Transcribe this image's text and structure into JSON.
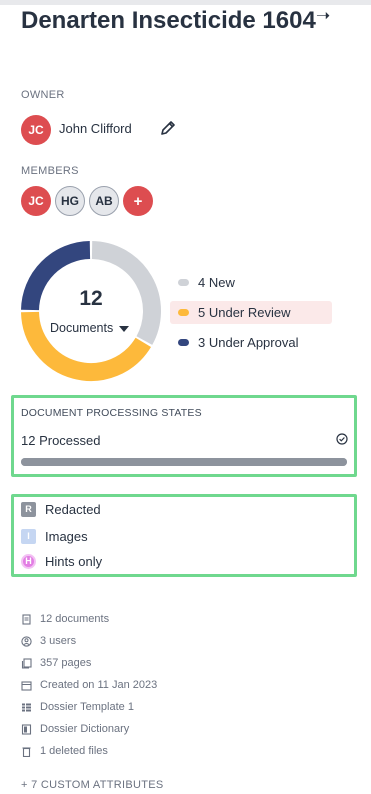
{
  "header": {
    "title": "Denarten Insecticide 1604",
    "collapse_icon": "arrow-right-icon"
  },
  "owner": {
    "label": "OWNER",
    "initials": "JC",
    "name": "John Clifford",
    "edit_icon": "pencil-icon"
  },
  "members": {
    "label": "MEMBERS",
    "items": [
      {
        "initials": "JC",
        "color": "#dd4d50"
      },
      {
        "initials": "HG",
        "color": "#e5e7eb"
      },
      {
        "initials": "AB",
        "color": "#e5e7eb"
      }
    ],
    "add_label": "+"
  },
  "documents_chart": {
    "count": "12",
    "selector_label": "Documents",
    "legend": [
      {
        "label": "4 New",
        "color": "#cfd2d7",
        "active": false
      },
      {
        "label": "5 Under Review",
        "color": "#fdb93b",
        "active": true
      },
      {
        "label": "3 Under Approval",
        "color": "#33467e",
        "active": false
      }
    ]
  },
  "chart_data": {
    "type": "pie",
    "categories": [
      "New",
      "Under Review",
      "Under Approval"
    ],
    "values": [
      4,
      5,
      3
    ],
    "colors": [
      "#cfd2d7",
      "#fdb93b",
      "#33467e"
    ]
  },
  "processing": {
    "label": "DOCUMENT PROCESSING STATES",
    "status": "12 Processed",
    "progress": 1.0,
    "status_icon": "check-circle-icon"
  },
  "filters": [
    {
      "chip": "R",
      "label": "Redacted",
      "type": "redacted"
    },
    {
      "chip": "I",
      "label": "Images",
      "type": "images"
    },
    {
      "chip": "H",
      "label": "Hints only",
      "type": "hints"
    }
  ],
  "stats": [
    {
      "icon": "document-icon",
      "label": "12 documents"
    },
    {
      "icon": "users-icon",
      "label": "3 users"
    },
    {
      "icon": "pages-icon",
      "label": "357 pages"
    },
    {
      "icon": "calendar-icon",
      "label": "Created on 11 Jan 2023"
    },
    {
      "icon": "template-icon",
      "label": "Dossier Template 1"
    },
    {
      "icon": "dictionary-icon",
      "label": "Dossier Dictionary"
    },
    {
      "icon": "trash-icon",
      "label": "1 deleted files"
    }
  ],
  "custom_attributes_label": "+ 7 CUSTOM ATTRIBUTES"
}
